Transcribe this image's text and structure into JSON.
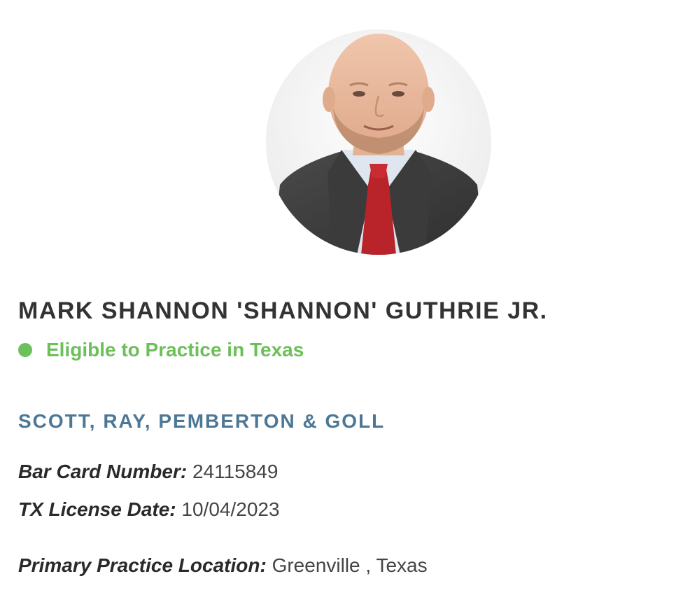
{
  "attorney": {
    "name": "MARK SHANNON 'SHANNON' GUTHRIE JR.",
    "status": "Eligible to Practice in Texas",
    "firm": "SCOTT, RAY, PEMBERTON & GOLL",
    "details": {
      "bar_card_label": "Bar Card Number:",
      "bar_card_value": "24115849",
      "license_label": "TX License Date:",
      "license_value": "10/04/2023",
      "location_label": "Primary Practice Location:",
      "location_value": "Greenville , Texas"
    }
  },
  "colors": {
    "status_green": "#6cbf59",
    "firm_blue": "#4d7895",
    "text_dark": "#333333"
  }
}
